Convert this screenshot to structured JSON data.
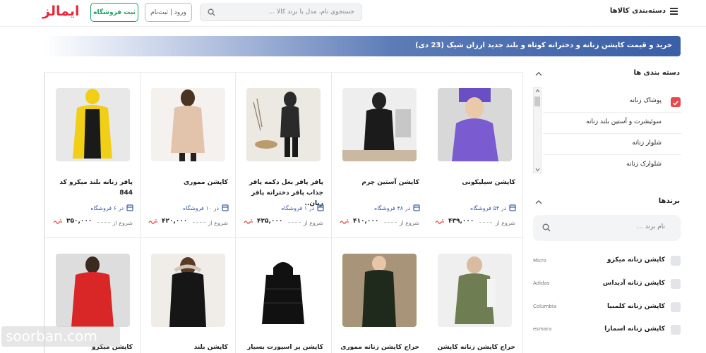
{
  "header": {
    "logo_text": "ایمالز",
    "register_label": "ثبت فروشگاه",
    "login_label": "ورود | ثبت‌نام",
    "search_placeholder": "جستجوی نام، مدل یا برند کالا ...",
    "categories_label": "دسته‌بندی کالاها"
  },
  "banner": {
    "title": "خرید و قیمت کاپشن زنانه و دخترانه کوتاه و بلند جدید ارزان شیک (23 دی)"
  },
  "sidebar": {
    "categories_title": "دسته بندی ها",
    "categories": [
      {
        "label": "پوشاک زنانه",
        "checked": true
      },
      {
        "label": "سوئیشرت و آستین بلند زنانه",
        "checked": false
      },
      {
        "label": "شلوار زنانه",
        "checked": false
      },
      {
        "label": "شلوارک زنانه",
        "checked": false
      }
    ],
    "brands_title": "برندها",
    "brand_search_placeholder": "نام برند ...",
    "brands": [
      {
        "name": "کاپشن زنانه میکرو",
        "en": "Micro"
      },
      {
        "name": "کاپشن زنانه آدیداس",
        "en": "Adidas"
      },
      {
        "name": "کاپشن زنانه کلمبیا",
        "en": "Columbia"
      },
      {
        "name": "کاپشن زنانه اسمارا",
        "en": "esmara"
      }
    ]
  },
  "products": [
    {
      "name": "کاپشن سیلیکونی",
      "stores": "در ۵۴ فروشگاه",
      "from": "شروع از",
      "price": "۴۳۹,۰۰۰",
      "color": "#7a5bd0"
    },
    {
      "name": "کاپشن آستین چرم",
      "stores": "در ۴۸ فروشگاه",
      "from": "شروع از",
      "price": "۴۱۰,۰۰۰",
      "color": "#1b1b1b"
    },
    {
      "name": "پافر پافر بغل دکمه پافر جذاب پافر دخترانه پافر زنان..",
      "stores": "در ۱ فروشگاه",
      "from": "شروع از",
      "price": "۴۲۵,۰۰۰",
      "color": "#2a2a2a"
    },
    {
      "name": "کاپشن مموری",
      "stores": "در ۱۰ فروشگاه",
      "from": "شروع از",
      "price": "۴۲۰,۰۰۰",
      "color": "#e2c3ab"
    },
    {
      "name": "پافر زنانه بلند میکرو کد 844",
      "stores": "در ۶ فروشگاه",
      "from": "شروع از",
      "price": "۳۵۰,۰۰۰",
      "color": "#f0cf16"
    },
    {
      "name": "حراج کاپشن زنانه کاپشن دخترانه",
      "stores": "",
      "from": "",
      "price": "",
      "color": "#6f7d52"
    },
    {
      "name": "حراج کاپشن زنانه مموری",
      "stores": "",
      "from": "",
      "price": "",
      "color": "#1f2a1c"
    },
    {
      "name": "کاپشن پر اسپورت بسیار",
      "stores": "",
      "from": "",
      "price": "",
      "color": "#111111"
    },
    {
      "name": "کاپشن بلند",
      "stores": "",
      "from": "",
      "price": "",
      "color": "#161616"
    },
    {
      "name": "کاپشن میکرو",
      "stores": "",
      "from": "",
      "price": "",
      "color": "#d92626"
    }
  ],
  "watermark": "soorban.com"
}
